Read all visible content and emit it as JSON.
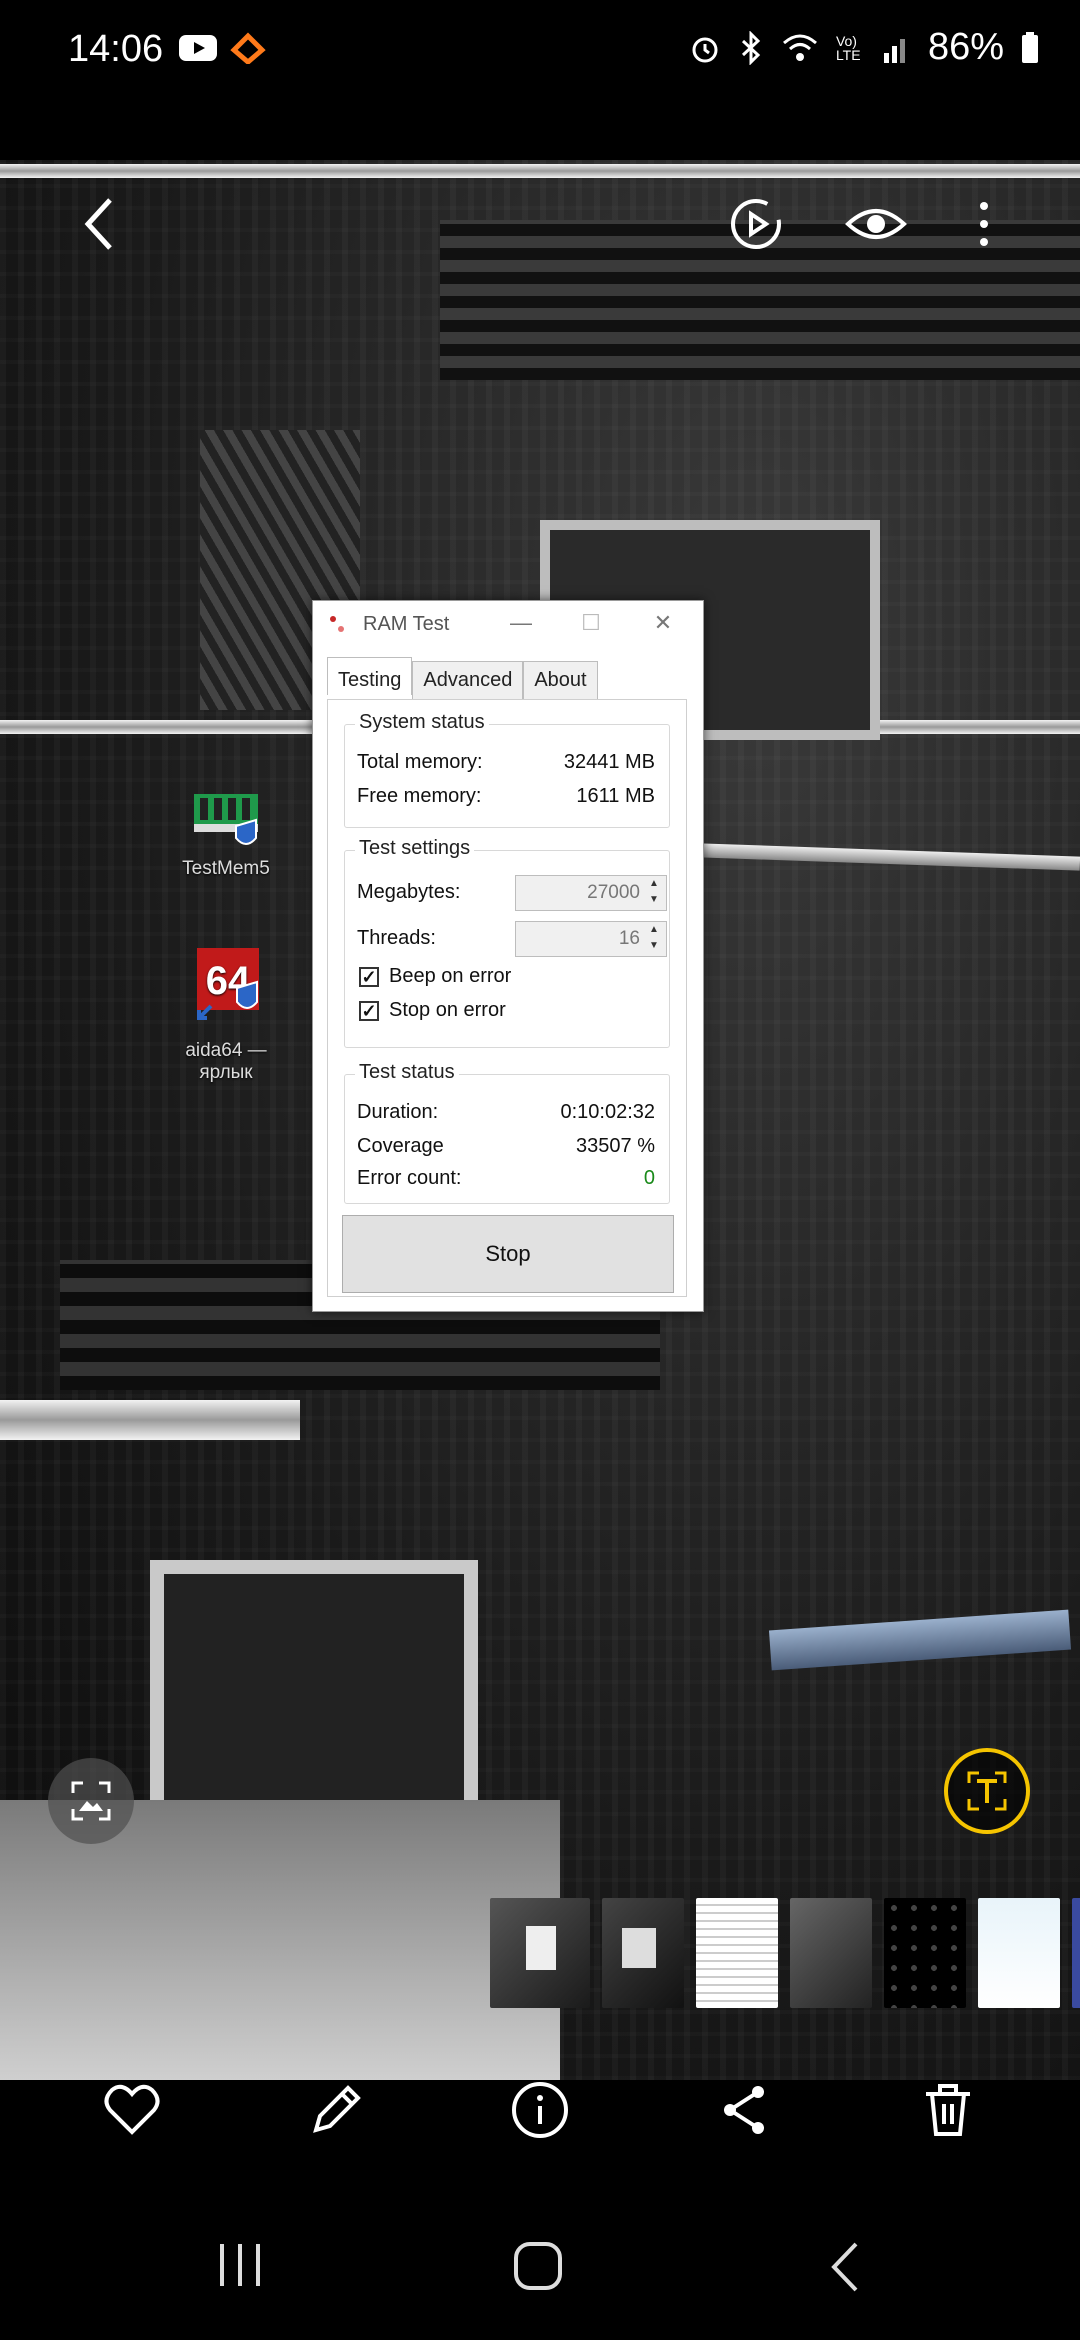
{
  "status_bar": {
    "time": "14:06",
    "battery": "86%",
    "network": "Vo) LTE",
    "icons": [
      "youtube-icon",
      "app-icon",
      "alarm-icon",
      "bluetooth-icon",
      "wifi-icon",
      "signal-icon",
      "battery-icon"
    ]
  },
  "top_toolbar": {
    "icons": [
      "back-icon",
      "motion-photo-icon",
      "eye-icon",
      "more-icon"
    ]
  },
  "desktop_icons": [
    {
      "label": "TestMem5",
      "icon": "ram-module-icon"
    },
    {
      "label": "aida64 —",
      "label2": "ярлык",
      "icon": "aida64-icon",
      "badge": "64"
    }
  ],
  "dialog": {
    "title": "RAM Test",
    "window_buttons": {
      "minimize": "—",
      "maximize": "☐",
      "close": "✕"
    },
    "tabs": [
      {
        "label": "Testing",
        "active": true
      },
      {
        "label": "Advanced",
        "active": false
      },
      {
        "label": "About",
        "active": false
      }
    ],
    "system_status": {
      "title": "System status",
      "total_memory_label": "Total memory:",
      "total_memory_value": "32441 MB",
      "free_memory_label": "Free memory:",
      "free_memory_value": "1611 MB"
    },
    "test_settings": {
      "title": "Test settings",
      "megabytes_label": "Megabytes:",
      "megabytes_value": "27000",
      "threads_label": "Threads:",
      "threads_value": "16",
      "beep_on_error_label": "Beep on error",
      "beep_on_error_checked": true,
      "stop_on_error_label": "Stop on error",
      "stop_on_error_checked": true
    },
    "test_status": {
      "title": "Test status",
      "duration_label": "Duration:",
      "duration_value": "0:10:02:32",
      "coverage_label": "Coverage",
      "coverage_value": "33507 %",
      "error_count_label": "Error count:",
      "error_count_value": "0"
    },
    "stop_label": "Stop"
  },
  "floating": {
    "left": "image-scan-icon",
    "right": "text-extract-icon",
    "right_accent": "#f5c400"
  },
  "thumbnails": [
    "thumb-1",
    "thumb-2",
    "thumb-3",
    "thumb-4",
    "thumb-5",
    "thumb-6",
    "thumb-7"
  ],
  "actions": [
    "favorite-icon",
    "edit-icon",
    "info-icon",
    "share-icon",
    "delete-icon"
  ],
  "navbar": [
    "recents-icon",
    "home-icon",
    "back-nav-icon"
  ],
  "colors": {
    "error_count_green": "#1a8a1a",
    "dialog_bg": "#ffffff"
  }
}
